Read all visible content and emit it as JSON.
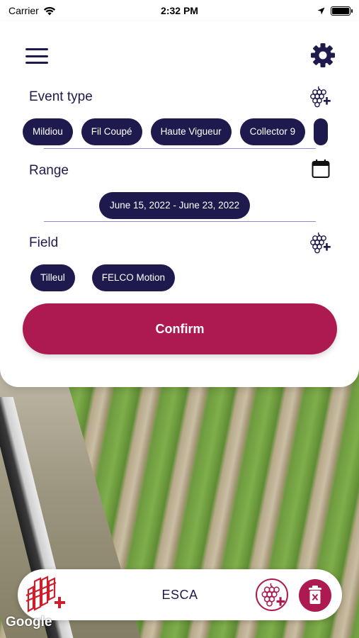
{
  "status_bar": {
    "carrier": "Carrier",
    "time": "2:32 PM"
  },
  "filters": {
    "event_type": {
      "title": "Event type",
      "chips": [
        "Mildiou",
        "Fil Coupé",
        "Haute Vigueur",
        "Collector 9"
      ]
    },
    "range": {
      "title": "Range",
      "value": "June 15, 2022 - June 23, 2022"
    },
    "field": {
      "title": "Field",
      "chips": [
        "Tilleul",
        "FELCO Motion"
      ]
    },
    "confirm_label": "Confirm"
  },
  "bottom_bar": {
    "title": "ESCA"
  },
  "map": {
    "attribution": "Google"
  },
  "colors": {
    "primary": "#1f1a4d",
    "accent": "#ad1a52"
  },
  "icons": {
    "menu": "hamburger-menu-icon",
    "settings": "gear-icon",
    "add_event": "grape-plus-icon",
    "calendar": "calendar-icon",
    "vineyard_add": "vineyard-plus-icon",
    "delete": "trash-icon"
  }
}
